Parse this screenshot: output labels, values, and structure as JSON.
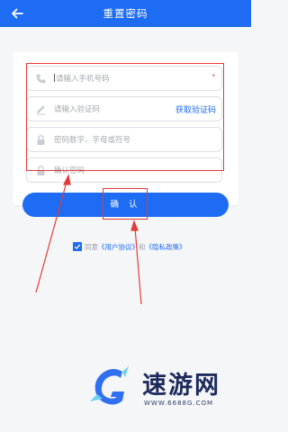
{
  "header": {
    "title": "重置密码",
    "back_icon": "back-arrow-icon"
  },
  "form": {
    "phone": {
      "placeholder": "请输入手机号码",
      "icon": "phone-icon",
      "required_mark": "*"
    },
    "code": {
      "placeholder": "请输入验证码",
      "icon": "pencil-icon",
      "action_label": "获取验证码"
    },
    "password": {
      "placeholder": "密码数字、字母或符号",
      "icon": "lock-icon"
    },
    "confirm_password": {
      "placeholder": "确认密码",
      "icon": "lock-icon"
    }
  },
  "confirm_button": {
    "label": "确 认"
  },
  "agreement": {
    "checked": true,
    "prefix": "同意",
    "user_agreement": "《用户协议》",
    "conjunction": "和",
    "privacy_policy": "《隐私政策》"
  },
  "watermark": {
    "name": "速游网",
    "url": "WWW.6688G.COM"
  },
  "colors": {
    "primary": "#1d6cf3",
    "annotation_red": "#e53a3a"
  }
}
